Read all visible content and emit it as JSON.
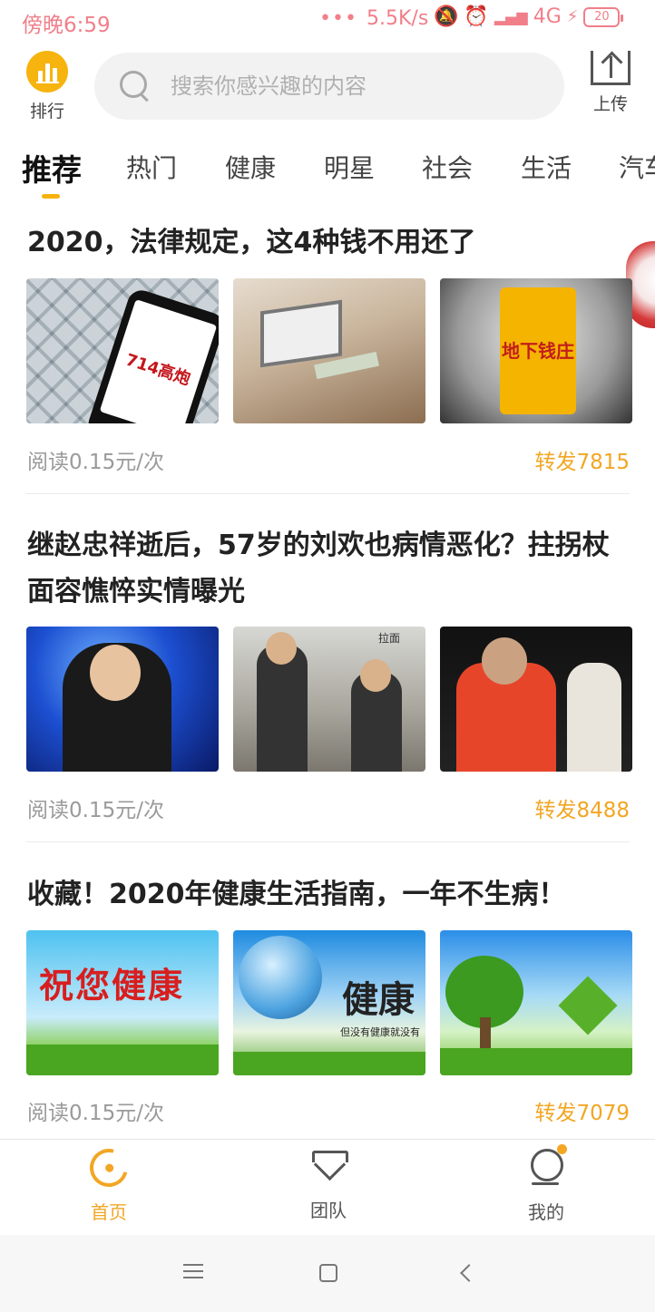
{
  "status_bar": {
    "time": "傍晚6:59",
    "dots": "•••",
    "speed": "5.5K/s",
    "network": "4G",
    "battery": "20",
    "color": "#f07f8a"
  },
  "header": {
    "rank_label": "排行",
    "search_placeholder": "搜索你感兴趣的内容",
    "upload_label": "上传",
    "accent": "#f7b30e"
  },
  "tabs": [
    "推荐",
    "热门",
    "健康",
    "明星",
    "社会",
    "生活",
    "汽车"
  ],
  "active_tab": "推荐",
  "articles": [
    {
      "title": "2020，法律规定，这4种钱不用还了",
      "read": "阅读0.15元/次",
      "share": "转发7815",
      "images": [
        {
          "icon": "phone-714-image",
          "text": "714高炮"
        },
        {
          "icon": "money-handover-image"
        },
        {
          "icon": "yen-underground-bank-image",
          "text": "地下钱庄"
        }
      ]
    },
    {
      "title": "继赵忠祥逝后，57岁的刘欢也病情恶化？拄拐杖面容憔悴实情曝光",
      "read": "阅读0.15元/次",
      "share": "转发8488",
      "images": [
        {
          "icon": "singer-on-stage-image"
        },
        {
          "icon": "man-with-crutch-image",
          "text": "拉面"
        },
        {
          "icon": "man-in-red-coat-image"
        }
      ]
    },
    {
      "title": "收藏！2020年健康生活指南，一年不生病！",
      "read": "阅读0.15元/次",
      "share": "转发7079",
      "images": [
        {
          "icon": "wish-health-image",
          "text": "祝您健康"
        },
        {
          "icon": "globe-hands-health-image",
          "text": "健康",
          "sub": "但没有健康就没有"
        },
        {
          "icon": "tree-heart-hands-image"
        }
      ]
    }
  ],
  "bottom_nav": [
    {
      "label": "首页",
      "icon": "home-icon",
      "active": true
    },
    {
      "label": "团队",
      "icon": "team-icon",
      "active": false
    },
    {
      "label": "我的",
      "icon": "profile-icon",
      "active": false,
      "badge": true
    }
  ],
  "colors": {
    "share": "#f2a623",
    "read": "#9a9a9a"
  }
}
